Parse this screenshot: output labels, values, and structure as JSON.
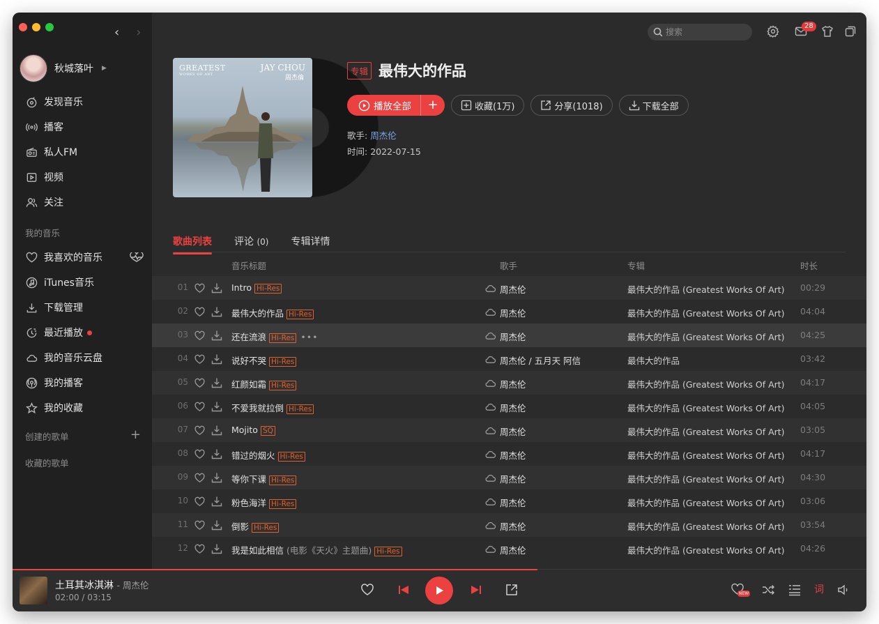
{
  "window": {
    "back_arrow": "‹",
    "forward_arrow": "›"
  },
  "user": {
    "name": "秋城落叶"
  },
  "sidebar": {
    "main_items": [
      {
        "label": "发现音乐",
        "icon": "discover-music-icon"
      },
      {
        "label": "播客",
        "icon": "podcast-icon"
      },
      {
        "label": "私人FM",
        "icon": "radio-icon"
      },
      {
        "label": "视频",
        "icon": "video-icon"
      },
      {
        "label": "关注",
        "icon": "follow-icon"
      }
    ],
    "my_music_title": "我的音乐",
    "my_music_items": [
      {
        "label": "我喜欢的音乐",
        "icon": "heart-icon"
      },
      {
        "label": "iTunes音乐",
        "icon": "music-note-icon"
      },
      {
        "label": "下载管理",
        "icon": "download-icon"
      },
      {
        "label": "最近播放",
        "icon": "recent-icon"
      },
      {
        "label": "我的音乐云盘",
        "icon": "cloud-icon"
      },
      {
        "label": "我的播客",
        "icon": "my-podcast-icon"
      },
      {
        "label": "我的收藏",
        "icon": "star-icon"
      }
    ],
    "created_playlists": "创建的歌单",
    "collected_playlists": "收藏的歌单"
  },
  "topbar": {
    "search_placeholder": "搜索",
    "mail_badge": "28"
  },
  "album": {
    "tag": "专辑",
    "title": "最伟大的作品",
    "cover_text": {
      "line1": "GREATEST",
      "line2": "WORKS OF ART",
      "artist_en": "JAY CHOU",
      "artist_cn": "周杰倫"
    },
    "play_all": "播放全部",
    "collect": "收藏(1万)",
    "share": "分享(1018)",
    "download_all": "下载全部",
    "artist_label": "歌手: ",
    "artist": "周杰伦",
    "date_label": "时间: ",
    "date": "2022-07-15"
  },
  "tabs": {
    "songs": "歌曲列表",
    "comments": "评论",
    "comments_count": "(0)",
    "details": "专辑详情"
  },
  "columns": {
    "title": "音乐标题",
    "artist": "歌手",
    "album": "专辑",
    "duration": "时长"
  },
  "songs": [
    {
      "idx": "01",
      "title": "Intro",
      "sub": "",
      "quality": "Hi-Res",
      "artist": "周杰伦",
      "album": "最伟大的作品 (Greatest Works Of Art)",
      "duration": "00:29"
    },
    {
      "idx": "02",
      "title": "最伟大的作品",
      "sub": "",
      "quality": "Hi-Res",
      "artist": "周杰伦",
      "album": "最伟大的作品 (Greatest Works Of Art)",
      "duration": "04:04"
    },
    {
      "idx": "03",
      "title": "还在流浪",
      "sub": "",
      "quality": "Hi-Res",
      "artist": "周杰伦",
      "album": "最伟大的作品 (Greatest Works Of Art)",
      "duration": "04:25"
    },
    {
      "idx": "04",
      "title": "说好不哭",
      "sub": "",
      "quality": "Hi-Res",
      "artist": "周杰伦 / 五月天 阿信",
      "album": "最伟大的作品",
      "duration": "03:42"
    },
    {
      "idx": "05",
      "title": "红颜如霜",
      "sub": "",
      "quality": "Hi-Res",
      "artist": "周杰伦",
      "album": "最伟大的作品 (Greatest Works Of Art)",
      "duration": "04:17"
    },
    {
      "idx": "06",
      "title": "不爱我就拉倒",
      "sub": "",
      "quality": "Hi-Res",
      "artist": "周杰伦",
      "album": "最伟大的作品 (Greatest Works Of Art)",
      "duration": "04:05"
    },
    {
      "idx": "07",
      "title": "Mojito",
      "sub": "",
      "quality": "SQ",
      "artist": "周杰伦",
      "album": "最伟大的作品 (Greatest Works Of Art)",
      "duration": "03:05"
    },
    {
      "idx": "08",
      "title": "错过的烟火",
      "sub": "",
      "quality": "Hi-Res",
      "artist": "周杰伦",
      "album": "最伟大的作品 (Greatest Works Of Art)",
      "duration": "04:17"
    },
    {
      "idx": "09",
      "title": "等你下课",
      "sub": "",
      "quality": "Hi-Res",
      "artist": "周杰伦",
      "album": "最伟大的作品 (Greatest Works Of Art)",
      "duration": "04:30"
    },
    {
      "idx": "10",
      "title": "粉色海洋",
      "sub": "",
      "quality": "Hi-Res",
      "artist": "周杰伦",
      "album": "最伟大的作品 (Greatest Works Of Art)",
      "duration": "03:06"
    },
    {
      "idx": "11",
      "title": "倒影",
      "sub": "",
      "quality": "Hi-Res",
      "artist": "周杰伦",
      "album": "最伟大的作品 (Greatest Works Of Art)",
      "duration": "03:54"
    },
    {
      "idx": "12",
      "title": "我是如此相信",
      "sub": "(电影《天火》主题曲)",
      "quality": "Hi-Res",
      "artist": "周杰伦",
      "album": "最伟大的作品 (Greatest Works Of Art)",
      "duration": "04:26"
    }
  ],
  "player": {
    "song": "土耳其冰淇淋",
    "artist": "周杰伦",
    "elapsed": "02:00",
    "total": "03:15",
    "progress_fraction": 0.615,
    "lyric_label": "词",
    "new_badge": "NEW"
  },
  "colors": {
    "accent": "#ec4141",
    "hires": "#e0612c",
    "link": "#7aa9e6"
  }
}
